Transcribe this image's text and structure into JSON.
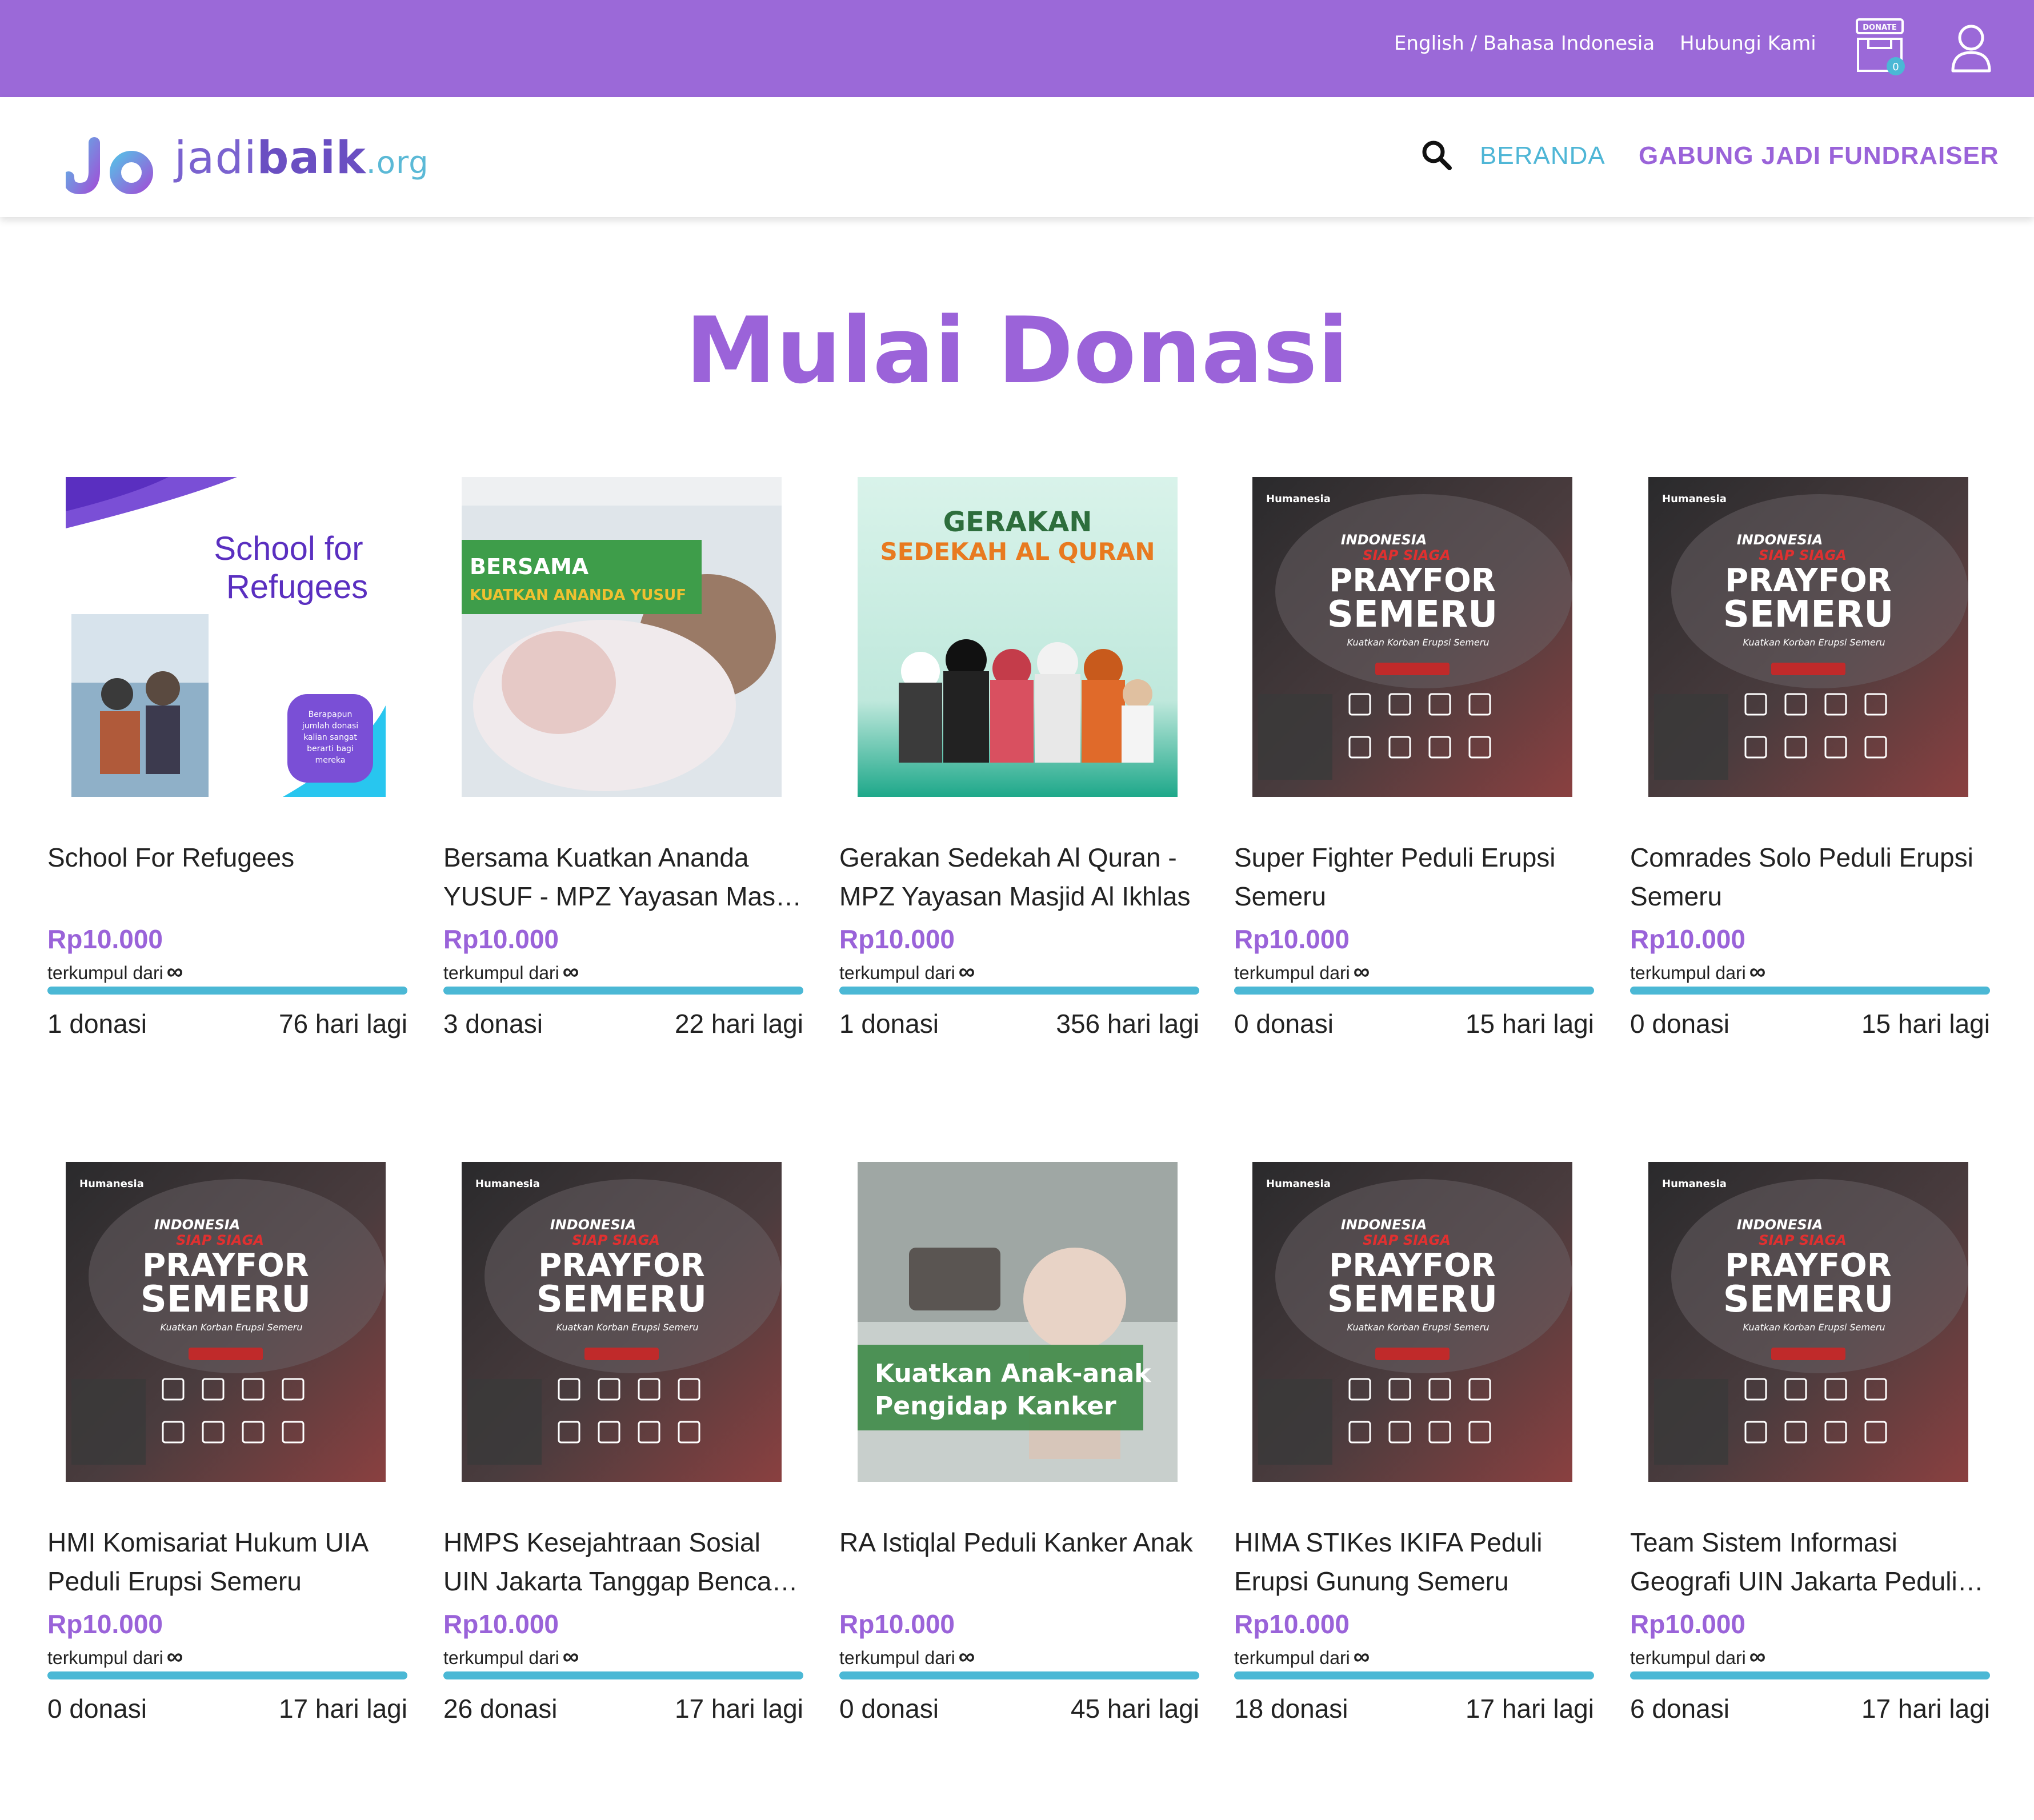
{
  "topbar": {
    "language": "English / Bahasa Indonesia",
    "contact": "Hubungi Kami",
    "cart_badge_label": "DONATE",
    "cart_count": "0"
  },
  "navbar": {
    "logo": {
      "part1": "jadi",
      "part2": "baik",
      "part3": ".org"
    },
    "beranda": "BERANDA",
    "gabung": "GABUNG JADI FUNDRAISER"
  },
  "heading": "Mulai Donasi",
  "colors": {
    "topbar": "#9b69d8",
    "accent": "#9a63d9",
    "teal": "#4bb8d5"
  },
  "cards": [
    {
      "title": "School For Refugees",
      "amount": "Rp10.000",
      "sub": "terkumpul dari",
      "inf": "∞",
      "donors": "1 donasi",
      "days": "76 hari lagi",
      "image": "school-for-refugees-poster"
    },
    {
      "title": "Bersama Kuatkan Ananda YUSUF - MPZ Yayasan Masjid Al Ikhlas",
      "amount": "Rp10.000",
      "sub": "terkumpul dari",
      "inf": "∞",
      "donors": "3 donasi",
      "days": "22 hari lagi",
      "image": "bersama-kuatkan-ananda-yusuf-poster"
    },
    {
      "title": "Gerakan Sedekah Al Quran - MPZ Yayasan Masjid Al Ikhlas",
      "amount": "Rp10.000",
      "sub": "terkumpul dari",
      "inf": "∞",
      "donors": "1 donasi",
      "days": "356 hari lagi",
      "image": "gerakan-sedekah-al-quran-poster"
    },
    {
      "title": "Super Fighter Peduli Erupsi Semeru",
      "amount": "Rp10.000",
      "sub": "terkumpul dari",
      "inf": "∞",
      "donors": "0 donasi",
      "days": "15 hari lagi",
      "image": "pray-for-semeru-poster"
    },
    {
      "title": "Comrades Solo Peduli Erupsi Semeru",
      "amount": "Rp10.000",
      "sub": "terkumpul dari",
      "inf": "∞",
      "donors": "0 donasi",
      "days": "15 hari lagi",
      "image": "pray-for-semeru-poster"
    },
    {
      "title": "HMI Komisariat Hukum UIA Peduli Erupsi Semeru",
      "amount": "Rp10.000",
      "sub": "terkumpul dari",
      "inf": "∞",
      "donors": "0 donasi",
      "days": "17 hari lagi",
      "image": "pray-for-semeru-poster"
    },
    {
      "title": "HMPS Kesejahtraan Sosial UIN Jakarta Tanggap Bencana Semeru",
      "amount": "Rp10.000",
      "sub": "terkumpul dari",
      "inf": "∞",
      "donors": "26 donasi",
      "days": "17 hari lagi",
      "image": "pray-for-semeru-poster"
    },
    {
      "title": "RA Istiqlal Peduli Kanker Anak",
      "amount": "Rp10.000",
      "sub": "terkumpul dari",
      "inf": "∞",
      "donors": "0 donasi",
      "days": "45 hari lagi",
      "image": "kuatkan-anak-kanker-poster"
    },
    {
      "title": "HIMA STIKes IKIFA Peduli Erupsi Gunung Semeru",
      "amount": "Rp10.000",
      "sub": "terkumpul dari",
      "inf": "∞",
      "donors": "18 donasi",
      "days": "17 hari lagi",
      "image": "pray-for-semeru-poster"
    },
    {
      "title": "Team Sistem Informasi Geografi UIN Jakarta Peduli Semeru",
      "amount": "Rp10.000",
      "sub": "terkumpul dari",
      "inf": "∞",
      "donors": "6 donasi",
      "days": "17 hari lagi",
      "image": "pray-for-semeru-poster"
    }
  ],
  "posters": {
    "refugees": {
      "line1": "School for",
      "line2": "Refugees",
      "badge": "Berapapun jumlah donasi kalian sangat berarti bagi mereka"
    },
    "yusuf": {
      "line1": "BERSAMA",
      "line2": "KUATKAN ANANDA YUSUF"
    },
    "quran": {
      "line1": "GERAKAN",
      "line2": "SEDEKAH AL QURAN"
    },
    "semeru": {
      "brand": "Humanesia",
      "line1": "INDONESIA",
      "line2": "SIAP SIAGA",
      "line3": "PRAYFOR",
      "line4": "SEMERU",
      "line5": "Kuatkan Korban Erupsi Semeru"
    },
    "kanker": {
      "line1": "Kuatkan Anak-anak",
      "line2": "Pengidap Kanker"
    }
  }
}
